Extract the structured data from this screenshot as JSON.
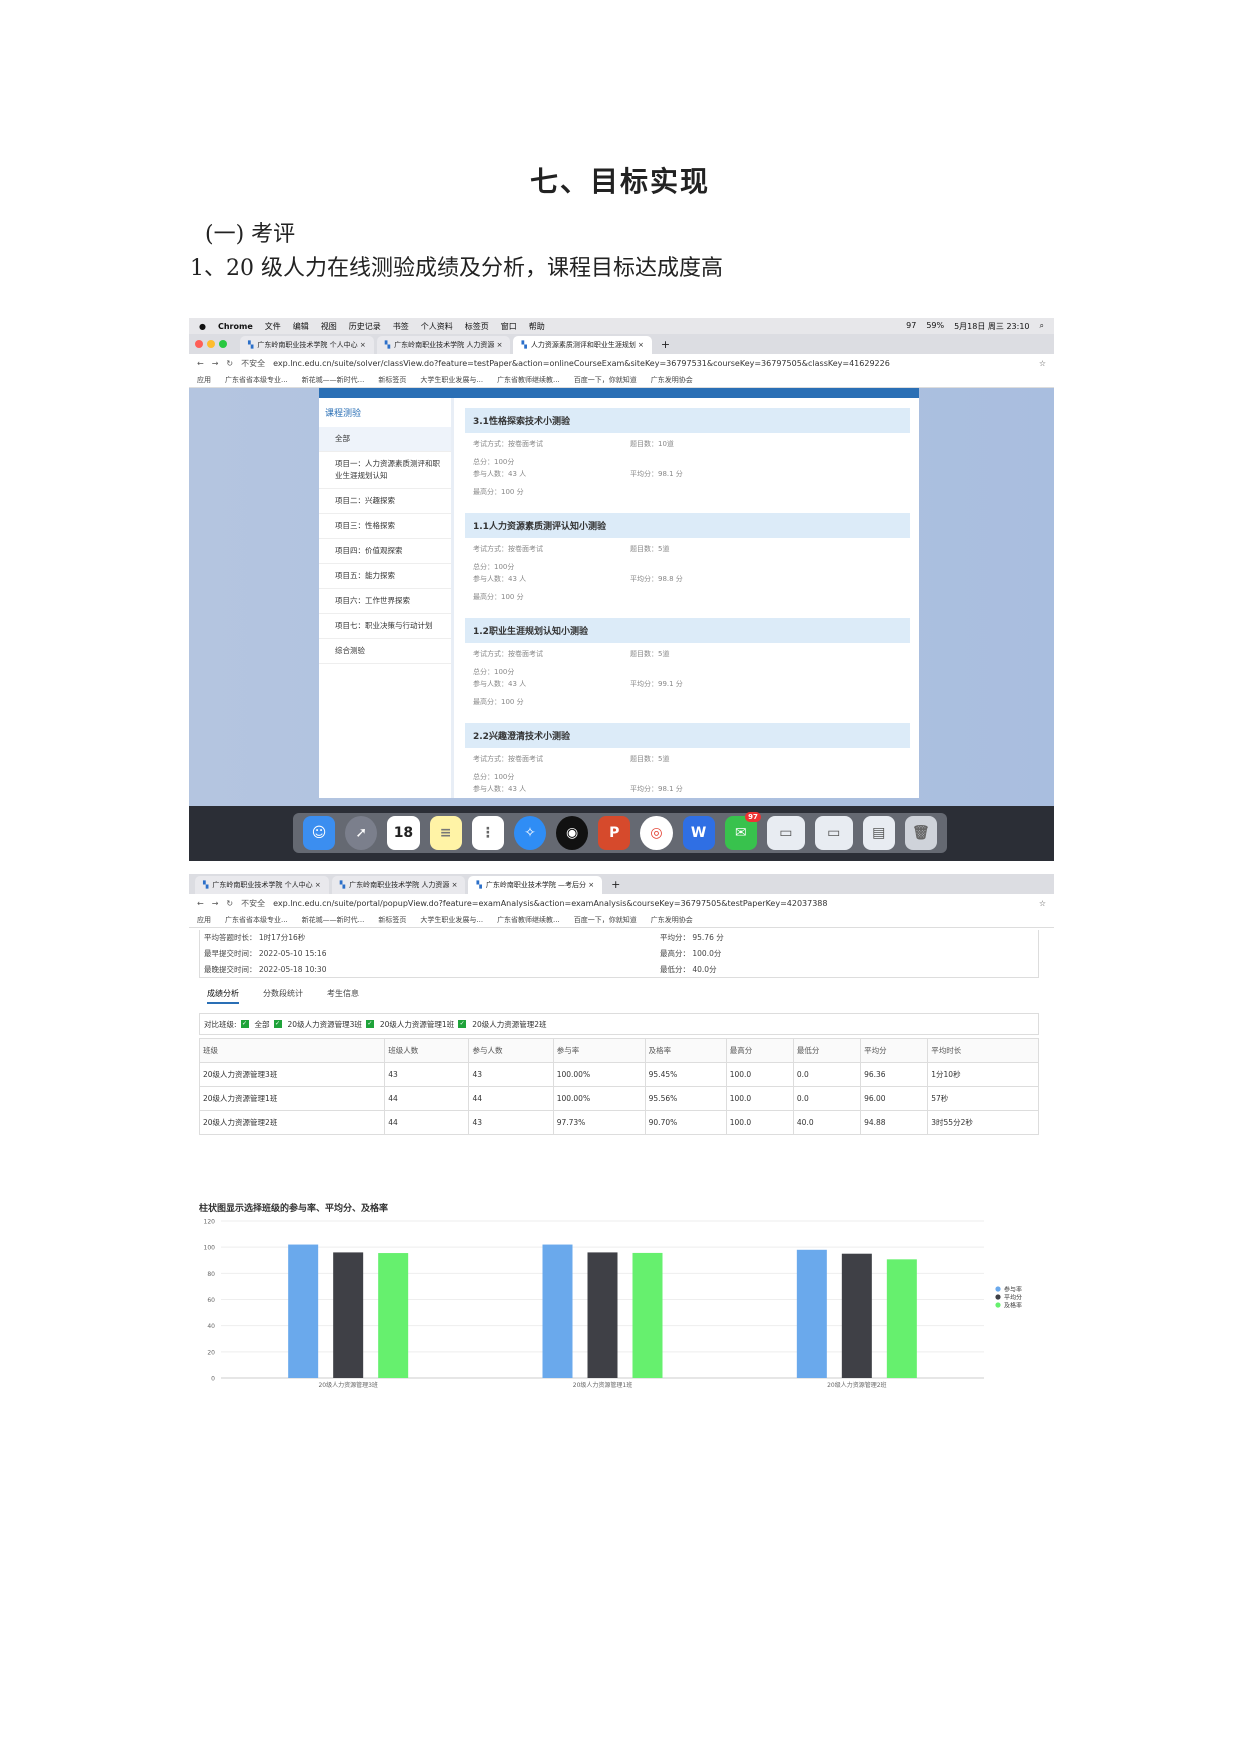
{
  "doc": {
    "title": "七、目标实现",
    "subtitle": "(一) 考评",
    "line": "1、20 级人力在线测验成绩及分析，课程目标达成度高"
  },
  "shot1": {
    "menubar": [
      "Chrome",
      "文件",
      "编辑",
      "视图",
      "历史记录",
      "书签",
      "个人资料",
      "标签页",
      "窗口",
      "帮助"
    ],
    "status": {
      "battery": "59%",
      "count": "97",
      "datetime": "5月18日 周三 23:10"
    },
    "tabs": [
      "广东岭南职业技术学院 个人中心",
      "广东岭南职业技术学院 人力资源",
      "人力资源素质测评和职业生涯规划"
    ],
    "address": {
      "security": "不安全",
      "url": "exp.lnc.edu.cn/suite/solver/classView.do?feature=testPaper&action=onlineCourseExam&siteKey=36797531&courseKey=36797505&classKey=41629226"
    },
    "bookmarks": [
      "应用",
      "广东省省本级专业...",
      "新花城——新时代...",
      "新标签页",
      "大学生职业发展与...",
      "广东省教师继续教...",
      "百度一下，你就知道",
      "广东发明协会"
    ],
    "sidebar": {
      "title": "课程测验",
      "items": [
        "全部",
        "项目一：人力资源素质测评和职业生涯规划认知",
        "项目二：兴趣探索",
        "项目三：性格探索",
        "项目四：价值观探索",
        "项目五：能力探索",
        "项目六：工作世界探索",
        "项目七：职业决策与行动计划",
        "综合测验"
      ]
    },
    "quizzes": [
      {
        "title": "3.1性格探索技术小测验",
        "mode": "考试方式：按卷面考试",
        "count": "题目数：10道",
        "total": "总分：100分",
        "people": "参与人数：43 人",
        "avg": "平均分：98.1 分",
        "max": "最高分：100 分"
      },
      {
        "title": "1.1人力资源素质测评认知小测验",
        "mode": "考试方式：按卷面考试",
        "count": "题目数：5道",
        "total": "总分：100分",
        "people": "参与人数：43 人",
        "avg": "平均分：98.8 分",
        "max": "最高分：100 分"
      },
      {
        "title": "1.2职业生涯规划认知小测验",
        "mode": "考试方式：按卷面考试",
        "count": "题目数：5道",
        "total": "总分：100分",
        "people": "参与人数：43 人",
        "avg": "平均分：99.1 分",
        "max": "最高分：100 分"
      },
      {
        "title": "2.2兴趣澄清技术小测验",
        "mode": "考试方式：按卷面考试",
        "count": "题目数：5道",
        "total": "总分：100分",
        "people": "参与人数：43 人",
        "avg": "平均分：98.1 分",
        "max": ""
      }
    ],
    "dock_date": "18",
    "dock_badge": "97"
  },
  "shot2": {
    "tabs": [
      "广东岭南职业技术学院 个人中心",
      "广东岭南职业技术学院 人力资源",
      "广东岭南职业技术学院 —考后分"
    ],
    "address": {
      "security": "不安全",
      "url": "exp.lnc.edu.cn/suite/portal/popupView.do?feature=examAnalysis&action=examAnalysis&courseKey=36797505&testPaperKey=42037388"
    },
    "summary": {
      "avg_time": "平均答题时长： 1时17分16秒",
      "earliest": "最早提交时间： 2022-05-10 15:16",
      "latest": "最晚提交时间： 2022-05-18 10:30",
      "avg_score": "平均分： 95.76 分",
      "max_score": "最高分： 100.0分",
      "min_score": "最低分： 40.0分"
    },
    "subtabs": [
      "成绩分析",
      "分数段统计",
      "考生信息"
    ],
    "filter": {
      "label": "对比班级:",
      "options": [
        "全部",
        "20级人力资源管理3班",
        "20级人力资源管理1班",
        "20级人力资源管理2班"
      ]
    },
    "table": {
      "headers": [
        "班级",
        "班级人数",
        "参与人数",
        "参与率",
        "及格率",
        "最高分",
        "最低分",
        "平均分",
        "平均时长"
      ],
      "rows": [
        [
          "20级人力资源管理3班",
          "43",
          "43",
          "100.00%",
          "95.45%",
          "100.0",
          "0.0",
          "96.36",
          "1分10秒"
        ],
        [
          "20级人力资源管理1班",
          "44",
          "44",
          "100.00%",
          "95.56%",
          "100.0",
          "0.0",
          "96.00",
          "57秒"
        ],
        [
          "20级人力资源管理2班",
          "44",
          "43",
          "97.73%",
          "90.70%",
          "100.0",
          "40.0",
          "94.88",
          "3时55分2秒"
        ]
      ]
    }
  },
  "chart_data": {
    "type": "bar",
    "title": "柱状图显示选择班级的参与率、平均分、及格率",
    "categories": [
      "20级人力资源管理3班",
      "20级人力资源管理1班",
      "20级人力资源管理2班"
    ],
    "series": [
      {
        "name": "参与率",
        "color": "#6aa9ec",
        "values": [
          102,
          102,
          98
        ]
      },
      {
        "name": "平均分",
        "color": "#3f4046",
        "values": [
          96,
          96,
          95
        ]
      },
      {
        "name": "及格率",
        "color": "#66f06e",
        "values": [
          95.5,
          95.6,
          90.7
        ]
      }
    ],
    "yticks": [
      0,
      20,
      40,
      60,
      80,
      100,
      120
    ],
    "ylim": [
      0,
      120
    ],
    "legend": "right"
  }
}
